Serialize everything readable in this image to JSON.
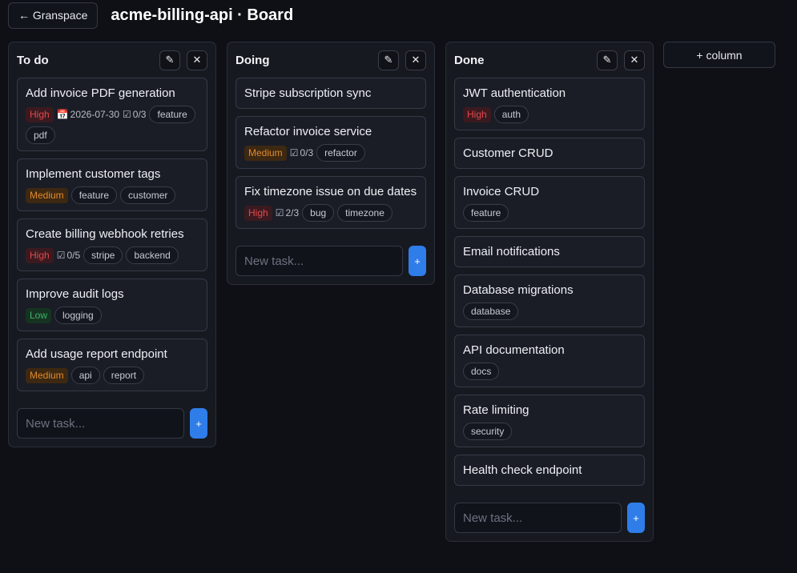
{
  "header": {
    "back_label": "← Granspace",
    "title": "acme-billing-api · Board"
  },
  "add_column_label": "+ column",
  "icons": {
    "edit": "✎",
    "close": "✕",
    "calendar": "📅",
    "checklist": "☑"
  },
  "add_task_label": "+",
  "new_task_placeholder": "New task...",
  "columns": [
    {
      "title": "To do",
      "cards": [
        {
          "title": "Add invoice PDF generation",
          "priority": "High",
          "due": "2026-07-30",
          "checklist": "0/3",
          "tags": [
            "feature",
            "pdf"
          ]
        },
        {
          "title": "Implement customer tags",
          "priority": "Medium",
          "tags": [
            "feature",
            "customer"
          ]
        },
        {
          "title": "Create billing webhook retries",
          "priority": "High",
          "checklist": "0/5",
          "tags": [
            "stripe",
            "backend"
          ]
        },
        {
          "title": "Improve audit logs",
          "priority": "Low",
          "tags": [
            "logging"
          ]
        },
        {
          "title": "Add usage report endpoint",
          "priority": "Medium",
          "tags": [
            "api",
            "report"
          ]
        }
      ]
    },
    {
      "title": "Doing",
      "cards": [
        {
          "title": "Stripe subscription sync",
          "tags": []
        },
        {
          "title": "Refactor invoice service",
          "priority": "Medium",
          "checklist": "0/3",
          "tags": [
            "refactor"
          ]
        },
        {
          "title": "Fix timezone issue on due dates",
          "priority": "High",
          "checklist": "2/3",
          "tags": [
            "bug",
            "timezone"
          ]
        }
      ]
    },
    {
      "title": "Done",
      "cards": [
        {
          "title": "JWT authentication",
          "priority": "High",
          "tags": [
            "auth"
          ]
        },
        {
          "title": "Customer CRUD",
          "tags": []
        },
        {
          "title": "Invoice CRUD",
          "tags": [
            "feature"
          ]
        },
        {
          "title": "Email notifications",
          "tags": []
        },
        {
          "title": "Database migrations",
          "tags": [
            "database"
          ]
        },
        {
          "title": "API documentation",
          "tags": [
            "docs"
          ]
        },
        {
          "title": "Rate limiting",
          "tags": [
            "security"
          ]
        },
        {
          "title": "Health check endpoint",
          "tags": []
        }
      ]
    }
  ]
}
